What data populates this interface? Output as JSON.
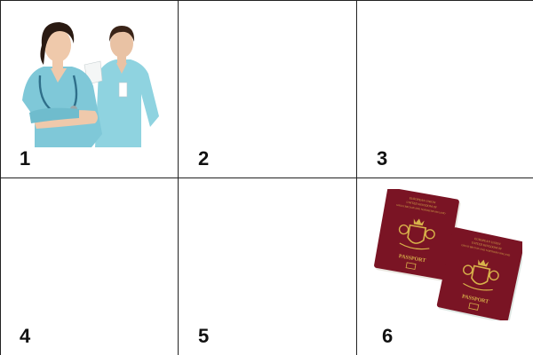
{
  "grid": {
    "cells": [
      {
        "number": "1",
        "image": "nurses-photo"
      },
      {
        "number": "2",
        "image": ""
      },
      {
        "number": "3",
        "image": ""
      },
      {
        "number": "4",
        "image": ""
      },
      {
        "number": "5",
        "image": ""
      },
      {
        "number": "6",
        "image": "passports-photo"
      }
    ]
  },
  "passport_cover_text": {
    "title": "PASSPORT",
    "header_line_1": "EUROPEAN UNION",
    "header_line_2": "UNITED KINGDOM OF",
    "header_line_3": "GREAT BRITAIN AND NORTHERN IRELAND"
  },
  "colors": {
    "border": "#222222",
    "scrubs": "#7fc8d8",
    "passport_red": "#7a1424",
    "passport_gold": "#d8b24a"
  }
}
